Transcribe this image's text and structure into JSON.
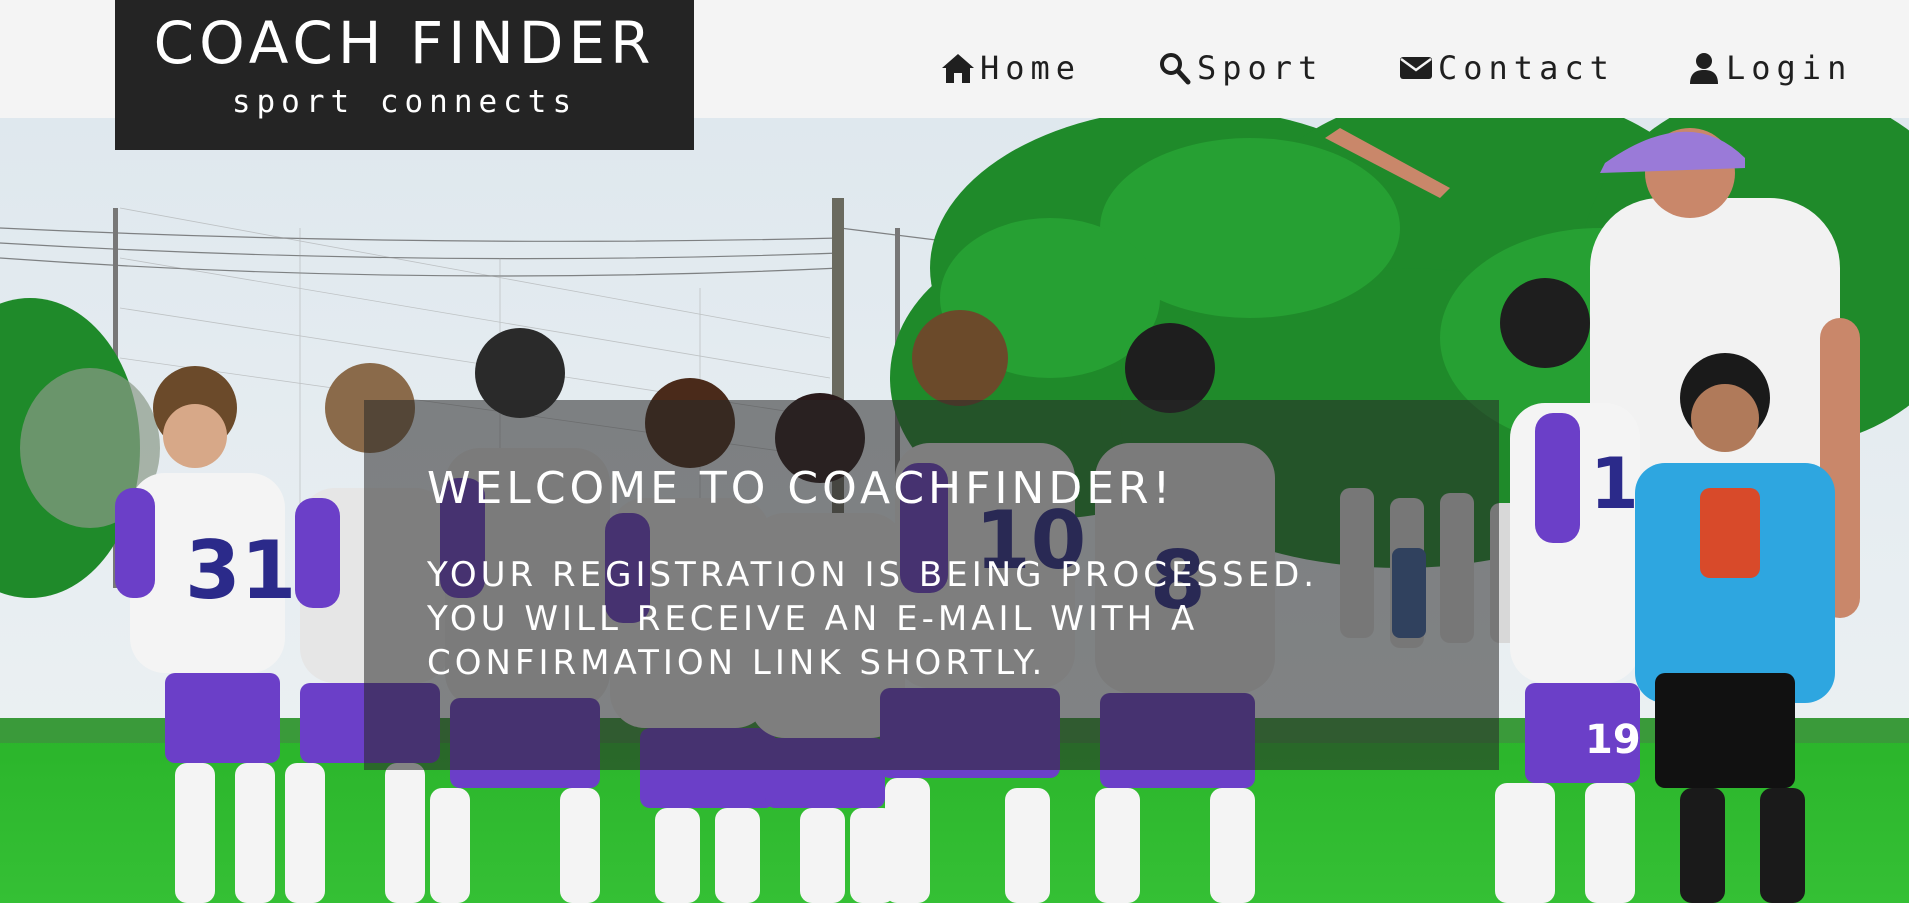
{
  "logo": {
    "title": "COACH FINDER",
    "subtitle": "sport connects"
  },
  "nav": {
    "items": [
      {
        "label": "Home",
        "icon": "home-icon"
      },
      {
        "label": "Sport",
        "icon": "search-icon"
      },
      {
        "label": "Contact",
        "icon": "envelope-icon"
      },
      {
        "label": "Login",
        "icon": "user-icon"
      }
    ]
  },
  "hero": {
    "heading": "Welcome to CoachFinder!",
    "message_lines": [
      "Your registration is being processed.",
      "You will receive an e-mail with a",
      "confirmation link shortly."
    ]
  },
  "colors": {
    "header_bg": "#f4f4f4",
    "logo_bg": "#242424",
    "text_dark": "#1f1f1f",
    "overlay": "rgba(40,40,40,0.55)",
    "jersey_purple": "#6b3fc8",
    "grass": "#2db82d",
    "trees": "#1f8a2a"
  }
}
